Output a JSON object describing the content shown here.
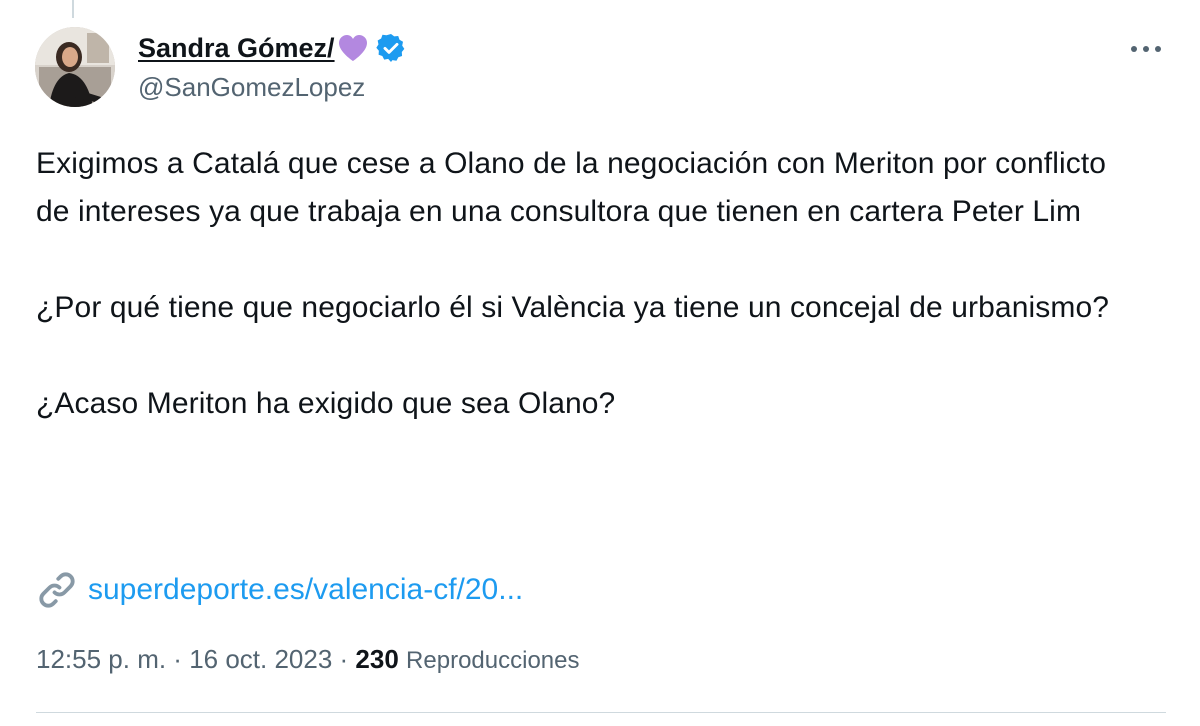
{
  "author": {
    "display_name": "Sandra Gómez/",
    "handle": "@SanGomezLopez",
    "heart_icon": "purple-heart-icon",
    "heart_color": "#b388e0",
    "verified_icon": "verified-badge-icon",
    "verified_color": "#1d9bf0"
  },
  "tweet": {
    "paragraphs": [
      "Exigimos a Catalá que cese a Olano de la negociación con Meriton por conflicto de intereses ya que trabaja en una consultora que tienen en cartera Peter Lim",
      "¿Por qué tiene que negociarlo él si València ya tiene un concejal de urbanismo?",
      "¿Acaso Meriton ha exigido que sea Olano?"
    ],
    "link": {
      "icon": "link-icon",
      "text": "superdeporte.es/valencia-cf/20..."
    }
  },
  "meta": {
    "time": "12:55 p. m.",
    "separator": " · ",
    "date": "16 oct. 2023",
    "views_count": "230",
    "views_label": "Reproducciones"
  },
  "colors": {
    "link": "#1d9bf0",
    "secondary_text": "#536471",
    "primary_text": "#0f1419"
  }
}
